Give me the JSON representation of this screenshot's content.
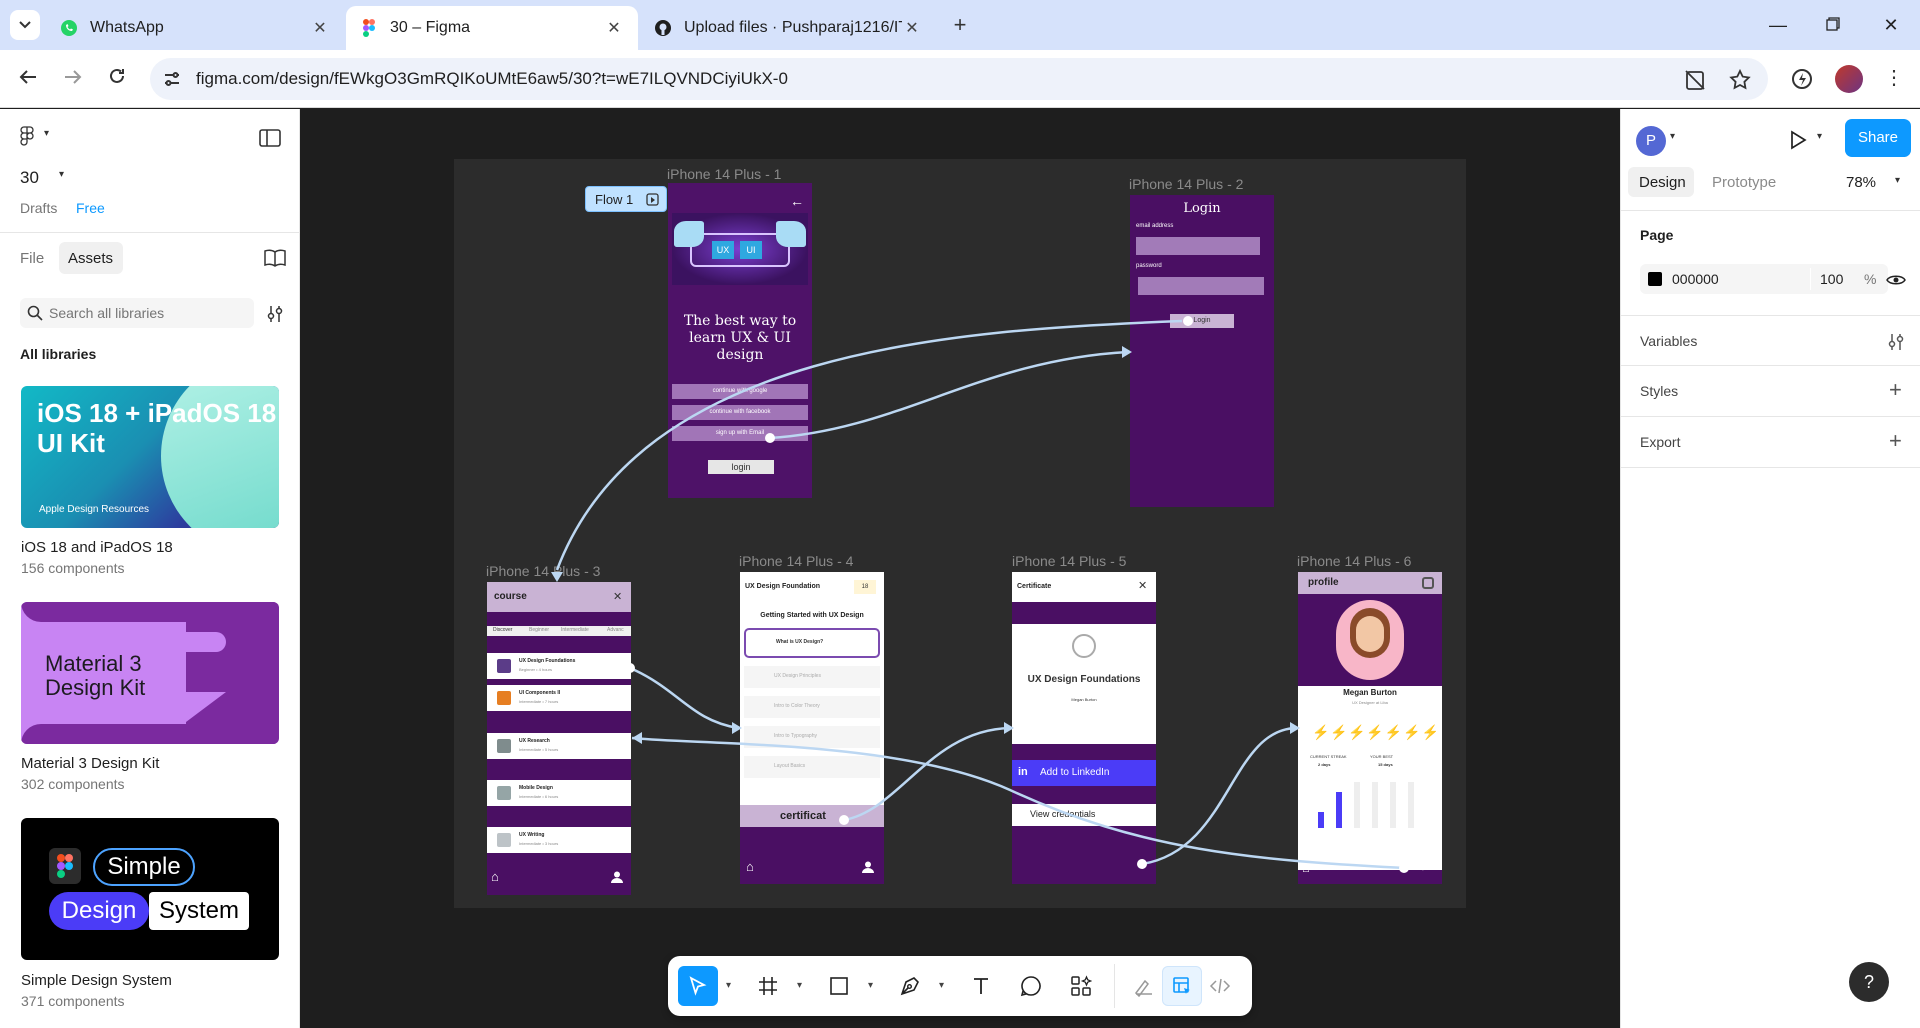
{
  "browser": {
    "tabs": [
      {
        "title": "WhatsApp",
        "favicon": "whatsapp-icon",
        "active": false
      },
      {
        "title": "30 – Figma",
        "favicon": "figma-icon",
        "active": true
      },
      {
        "title": "Upload files · Pushparaj1216/IT/",
        "favicon": "github-icon",
        "active": false
      }
    ],
    "url": "figma.com/design/fEWkgO3GmRQIKoUMtE6aw5/30?t=wE7ILQVNDCiyiUkX-0",
    "new_tab": "+"
  },
  "left_panel": {
    "file_name": "30",
    "drafts_label": "Drafts",
    "plan_label": "Free",
    "tab_file": "File",
    "tab_assets": "Assets",
    "search_placeholder": "Search all libraries",
    "section_title": "All libraries",
    "libraries": [
      {
        "thumb_title": "iOS 18 + iPadOS 18 UI Kit",
        "thumb_sub": "Apple Design Resources",
        "name": "iOS 18 and iPadOS 18",
        "count": "156 components"
      },
      {
        "thumb_title": "Material 3 Design Kit",
        "name": "Material 3 Design Kit",
        "count": "302 components"
      },
      {
        "thumb_words": [
          "Simple",
          "Design",
          "System"
        ],
        "name": "Simple Design System",
        "count": "371 components"
      }
    ]
  },
  "canvas": {
    "flow_label": "Flow 1",
    "frames": [
      {
        "label": "iPhone 14 Plus - 1"
      },
      {
        "label": "iPhone 14 Plus - 2"
      },
      {
        "label": "iPhone 14 Plus - 3"
      },
      {
        "label": "iPhone 14 Plus - 4"
      },
      {
        "label": "iPhone 14 Plus - 5"
      },
      {
        "label": "iPhone 14 Plus - 6"
      }
    ],
    "screen1": {
      "badges": [
        "UX",
        "UI"
      ],
      "headline": "The best way to learn UX & UI design",
      "buttons": [
        "continue with google",
        "continue with facebook",
        "sign up with Email"
      ],
      "login": "login"
    },
    "screen2": {
      "title": "Login",
      "email_label": "email address",
      "password_label": "password",
      "login_btn": "Login"
    },
    "screen3": {
      "title": "course",
      "tabs": [
        "Discover",
        "Beginner",
        "Intermediate",
        "Advanc"
      ],
      "items": [
        {
          "title": "UX Design Foundations",
          "sub": "Beginner • 4 hours"
        },
        {
          "title": "UI Components II",
          "sub": "Intermediate • 7 hours"
        },
        {
          "title": "UX Research",
          "sub": "Intermediate • 5 hours"
        },
        {
          "title": "Mobile Design",
          "sub": "Intermediate • 6 hours"
        },
        {
          "title": "UX Writing",
          "sub": "Intermediate • 3 hours"
        }
      ]
    },
    "screen4": {
      "title": "UX Design Foundation",
      "badge": "18",
      "subtitle": "Getting Started with UX Design",
      "lessons": [
        "What is UX Design?",
        "UX Design Principles",
        "Intro to Color Theory",
        "Intro to Typography",
        "Layout Basics"
      ],
      "cta": "certificat"
    },
    "screen5": {
      "title": "Certificate",
      "cert_title": "UX Design Foundations",
      "cert_name": "Megan Burton",
      "linkedin": "Add to LinkedIn",
      "credentials": "View credentials"
    },
    "screen6": {
      "title": "profile",
      "name": "Megan Burton",
      "role": "UX Designer at Liba",
      "stat1": "CURRENT STREAK",
      "stat1_val": "2 days",
      "stat2": "YOUR BEST",
      "stat2_val": "15 days"
    }
  },
  "toolbar": {
    "tools": [
      "move-tool",
      "frame-tool",
      "shape-tool",
      "pen-tool",
      "text-tool",
      "comment-tool",
      "actions-tool",
      "draw-mode",
      "design-mode",
      "dev-mode"
    ]
  },
  "right_panel": {
    "avatar_letter": "P",
    "share": "Share",
    "tab_design": "Design",
    "tab_prototype": "Prototype",
    "zoom": "78%",
    "page_section": "Page",
    "page_color": "000000",
    "page_opacity": "100",
    "percent_sign": "%",
    "variables": "Variables",
    "styles": "Styles",
    "export": "Export"
  },
  "help": "?"
}
